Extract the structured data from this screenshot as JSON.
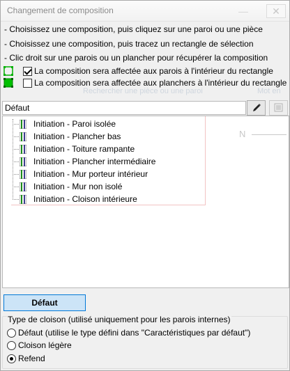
{
  "window": {
    "title": "Changement de composition"
  },
  "instructions": [
    "- Choisissez une composition, puis cliquez sur une paroi ou une pièce",
    "- Choisissez une composition, puis tracez un rectangle de sélection",
    "- Clic droit sur une parois ou un plancher pour récupérer la composition"
  ],
  "options": {
    "walls_label": "La composition sera affectée aux parois à l'intérieur du rectangle",
    "walls_checked": true,
    "floors_label": "La composition sera affectée aux planchers à l'intérieur du rectangle",
    "floors_checked": false
  },
  "ghost": {
    "underlay_text": "Rechercher une pièce ou une paroi",
    "underlay_mot": "Mot en",
    "north_label": "N"
  },
  "composition_combo": {
    "value": "Défaut"
  },
  "toolbar": {
    "edit_icon": "pencil-icon",
    "view_icon": "image-icon"
  },
  "tree_items": [
    "Initiation - Paroi isolée",
    "Initiation - Plancher bas",
    "Initiation - Toiture rampante",
    "Initiation - Plancher intermédiaire",
    "Initiation - Mur porteur intérieur",
    "Initiation - Mur non isolé",
    "Initiation - Cloison intérieure"
  ],
  "default_button": {
    "label": "Défaut"
  },
  "partition_type": {
    "legend": "Type de cloison (utilisé uniquement pour les parois internes)",
    "options": [
      "Défaut (utilise le type défini dans \"Caractéristiques par défaut\")",
      "Cloison légère",
      "Refend"
    ],
    "selected": "Refend"
  },
  "colors": {
    "accent": "#0078d7",
    "button_bg": "#cce4f7",
    "rect_icon": "#00c000"
  }
}
